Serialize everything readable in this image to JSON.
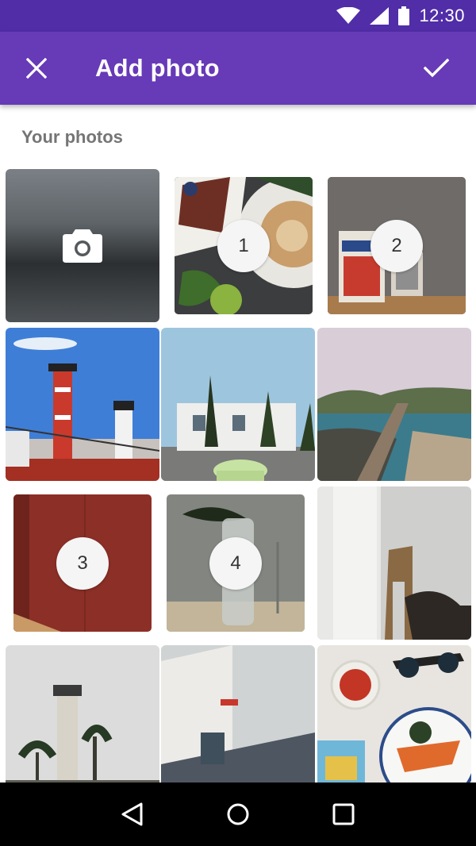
{
  "status_bar": {
    "time": "12:30",
    "icons": [
      "wifi-icon",
      "cell-signal-icon",
      "battery-icon"
    ]
  },
  "app_bar": {
    "title": "Add photo",
    "close_icon": "close-icon",
    "confirm_icon": "check-icon",
    "background": "#673ab7",
    "status_background": "#512da8"
  },
  "section": {
    "label": "Your photos"
  },
  "grid": {
    "camera_tile_icon": "camera-icon",
    "photos": [
      {
        "subject": "cake-and-coffee",
        "selected": true,
        "order": "1"
      },
      {
        "subject": "book-on-table",
        "selected": true,
        "order": "2"
      },
      {
        "subject": "red-lighthouse-ship",
        "selected": false,
        "order": ""
      },
      {
        "subject": "white-building-car",
        "selected": false,
        "order": ""
      },
      {
        "subject": "coast-pier",
        "selected": false,
        "order": ""
      },
      {
        "subject": "red-wall",
        "selected": true,
        "order": "3"
      },
      {
        "subject": "glass-bottle-leaf",
        "selected": true,
        "order": "4"
      },
      {
        "subject": "chair-and-door",
        "selected": false,
        "order": ""
      },
      {
        "subject": "lighthouse-palms",
        "selected": false,
        "order": ""
      },
      {
        "subject": "white-building-sign",
        "selected": false,
        "order": ""
      },
      {
        "subject": "food-and-sunglasses",
        "selected": false,
        "order": ""
      }
    ]
  },
  "nav_bar": {
    "icons": [
      "back-icon",
      "home-icon",
      "recents-icon"
    ]
  }
}
